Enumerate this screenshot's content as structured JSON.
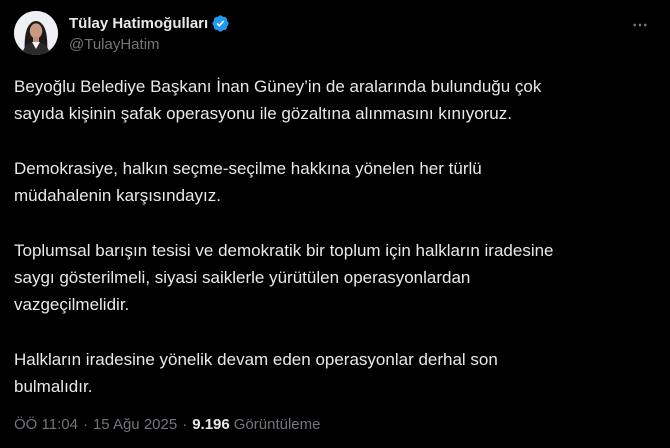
{
  "author": {
    "display_name": "Tülay Hatimoğulları",
    "handle": "@TulayHatim",
    "verified": true,
    "verified_color": "#1d9bf0"
  },
  "tweet": {
    "paragraphs": [
      [
        "Beyoğlu Belediye Başkanı İnan Güney’in de aralarında bulunduğu çok",
        "sayıda kişinin şafak operasyonu ile gözaltına alınmasını kınıyoruz."
      ],
      [
        "Demokrasiye, halkın seçme-seçilme hakkına yönelen her türlü",
        "müdahalenin karşısındayız."
      ],
      [
        "Toplumsal barışın tesisi ve demokratik bir toplum için halkların iradesine",
        "saygı gösterilmeli, siyasi saiklerle yürütülen operasyonlardan",
        "vazgeçilmelidir."
      ],
      [
        "Halkların iradesine yönelik devam eden operasyonlar derhal son",
        "bulmalıdır."
      ]
    ]
  },
  "meta": {
    "time": "ÖÖ 11:04",
    "separator": "·",
    "date": "15 Ağu 2025",
    "views_count": "9.196",
    "views_label": "Görüntüleme"
  },
  "icons": {
    "avatar": "avatar",
    "verified": "verified-badge-icon",
    "more": "more-options-icon"
  },
  "colors": {
    "background": "#000000",
    "text": "#e7e9ea",
    "secondary_text": "#71767b"
  }
}
